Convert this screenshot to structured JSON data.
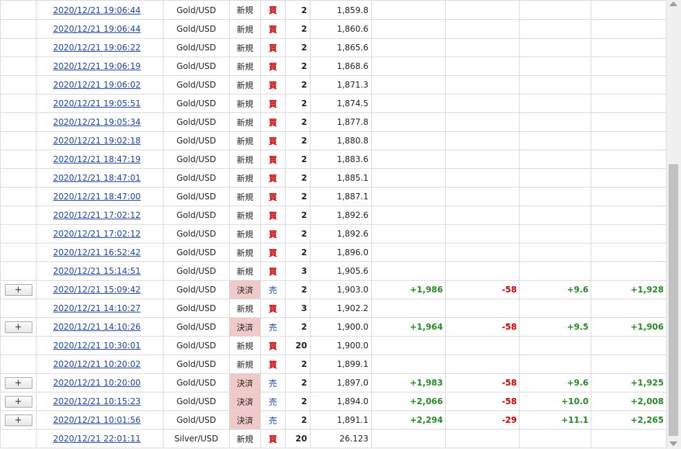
{
  "colors": {
    "positive": "#2a8a2a",
    "negative": "#cc0000",
    "link": "#1a44a8",
    "settle_bg": "#f2c9c9"
  },
  "rows": [
    {
      "expand": null,
      "datetime": "2020/12/21 19:06:44",
      "symbol": "Gold/USD",
      "type": "新規",
      "side": "買",
      "qty": "2",
      "price": "1,859.8",
      "c1": "",
      "c2": "",
      "c3": "",
      "c4": ""
    },
    {
      "expand": null,
      "datetime": "2020/12/21 19:06:44",
      "symbol": "Gold/USD",
      "type": "新規",
      "side": "買",
      "qty": "2",
      "price": "1,860.6",
      "c1": "",
      "c2": "",
      "c3": "",
      "c4": ""
    },
    {
      "expand": null,
      "datetime": "2020/12/21 19:06:22",
      "symbol": "Gold/USD",
      "type": "新規",
      "side": "買",
      "qty": "2",
      "price": "1,865.6",
      "c1": "",
      "c2": "",
      "c3": "",
      "c4": ""
    },
    {
      "expand": null,
      "datetime": "2020/12/21 19:06:19",
      "symbol": "Gold/USD",
      "type": "新規",
      "side": "買",
      "qty": "2",
      "price": "1,868.6",
      "c1": "",
      "c2": "",
      "c3": "",
      "c4": ""
    },
    {
      "expand": null,
      "datetime": "2020/12/21 19:06:02",
      "symbol": "Gold/USD",
      "type": "新規",
      "side": "買",
      "qty": "2",
      "price": "1,871.3",
      "c1": "",
      "c2": "",
      "c3": "",
      "c4": ""
    },
    {
      "expand": null,
      "datetime": "2020/12/21 19:05:51",
      "symbol": "Gold/USD",
      "type": "新規",
      "side": "買",
      "qty": "2",
      "price": "1,874.5",
      "c1": "",
      "c2": "",
      "c3": "",
      "c4": ""
    },
    {
      "expand": null,
      "datetime": "2020/12/21 19:05:34",
      "symbol": "Gold/USD",
      "type": "新規",
      "side": "買",
      "qty": "2",
      "price": "1,877.8",
      "c1": "",
      "c2": "",
      "c3": "",
      "c4": ""
    },
    {
      "expand": null,
      "datetime": "2020/12/21 19:02:18",
      "symbol": "Gold/USD",
      "type": "新規",
      "side": "買",
      "qty": "2",
      "price": "1,880.8",
      "c1": "",
      "c2": "",
      "c3": "",
      "c4": ""
    },
    {
      "expand": null,
      "datetime": "2020/12/21 18:47:19",
      "symbol": "Gold/USD",
      "type": "新規",
      "side": "買",
      "qty": "2",
      "price": "1,883.6",
      "c1": "",
      "c2": "",
      "c3": "",
      "c4": ""
    },
    {
      "expand": null,
      "datetime": "2020/12/21 18:47:01",
      "symbol": "Gold/USD",
      "type": "新規",
      "side": "買",
      "qty": "2",
      "price": "1,885.1",
      "c1": "",
      "c2": "",
      "c3": "",
      "c4": ""
    },
    {
      "expand": null,
      "datetime": "2020/12/21 18:47:00",
      "symbol": "Gold/USD",
      "type": "新規",
      "side": "買",
      "qty": "2",
      "price": "1,887.1",
      "c1": "",
      "c2": "",
      "c3": "",
      "c4": ""
    },
    {
      "expand": null,
      "datetime": "2020/12/21 17:02:12",
      "symbol": "Gold/USD",
      "type": "新規",
      "side": "買",
      "qty": "2",
      "price": "1,892.6",
      "c1": "",
      "c2": "",
      "c3": "",
      "c4": ""
    },
    {
      "expand": null,
      "datetime": "2020/12/21 17:02:12",
      "symbol": "Gold/USD",
      "type": "新規",
      "side": "買",
      "qty": "2",
      "price": "1,892.6",
      "c1": "",
      "c2": "",
      "c3": "",
      "c4": ""
    },
    {
      "expand": null,
      "datetime": "2020/12/21 16:52:42",
      "symbol": "Gold/USD",
      "type": "新規",
      "side": "買",
      "qty": "2",
      "price": "1,896.0",
      "c1": "",
      "c2": "",
      "c3": "",
      "c4": ""
    },
    {
      "expand": null,
      "datetime": "2020/12/21 15:14:51",
      "symbol": "Gold/USD",
      "type": "新規",
      "side": "買",
      "qty": "3",
      "price": "1,905.6",
      "c1": "",
      "c2": "",
      "c3": "",
      "c4": ""
    },
    {
      "expand": "+",
      "datetime": "2020/12/21 15:09:42",
      "symbol": "Gold/USD",
      "type": "決済",
      "side": "売",
      "qty": "2",
      "price": "1,903.0",
      "c1": "+1,986",
      "c2": "-58",
      "c3": "+9.6",
      "c4": "+1,928"
    },
    {
      "expand": null,
      "datetime": "2020/12/21 14:10:27",
      "symbol": "Gold/USD",
      "type": "新規",
      "side": "買",
      "qty": "3",
      "price": "1,902.2",
      "c1": "",
      "c2": "",
      "c3": "",
      "c4": ""
    },
    {
      "expand": "+",
      "datetime": "2020/12/21 14:10:26",
      "symbol": "Gold/USD",
      "type": "決済",
      "side": "売",
      "qty": "2",
      "price": "1,900.0",
      "c1": "+1,964",
      "c2": "-58",
      "c3": "+9.5",
      "c4": "+1,906"
    },
    {
      "expand": null,
      "datetime": "2020/12/21 10:30:01",
      "symbol": "Gold/USD",
      "type": "新規",
      "side": "買",
      "qty": "20",
      "price": "1,900.0",
      "c1": "",
      "c2": "",
      "c3": "",
      "c4": ""
    },
    {
      "expand": null,
      "datetime": "2020/12/21 10:20:02",
      "symbol": "Gold/USD",
      "type": "新規",
      "side": "買",
      "qty": "2",
      "price": "1,899.1",
      "c1": "",
      "c2": "",
      "c3": "",
      "c4": ""
    },
    {
      "expand": "+",
      "datetime": "2020/12/21 10:20:00",
      "symbol": "Gold/USD",
      "type": "決済",
      "side": "売",
      "qty": "2",
      "price": "1,897.0",
      "c1": "+1,983",
      "c2": "-58",
      "c3": "+9.6",
      "c4": "+1,925"
    },
    {
      "expand": "+",
      "datetime": "2020/12/21 10:15:23",
      "symbol": "Gold/USD",
      "type": "決済",
      "side": "売",
      "qty": "2",
      "price": "1,894.0",
      "c1": "+2,066",
      "c2": "-58",
      "c3": "+10.0",
      "c4": "+2,008"
    },
    {
      "expand": "+",
      "datetime": "2020/12/21 10:01:56",
      "symbol": "Gold/USD",
      "type": "決済",
      "side": "売",
      "qty": "2",
      "price": "1,891.1",
      "c1": "+2,294",
      "c2": "-29",
      "c3": "+11.1",
      "c4": "+2,265"
    },
    {
      "expand": null,
      "datetime": "2020/12/21 22:01:11",
      "symbol": "Silver/USD",
      "type": "新規",
      "side": "買",
      "qty": "20",
      "price": "26.123",
      "c1": "",
      "c2": "",
      "c3": "",
      "c4": ""
    }
  ]
}
